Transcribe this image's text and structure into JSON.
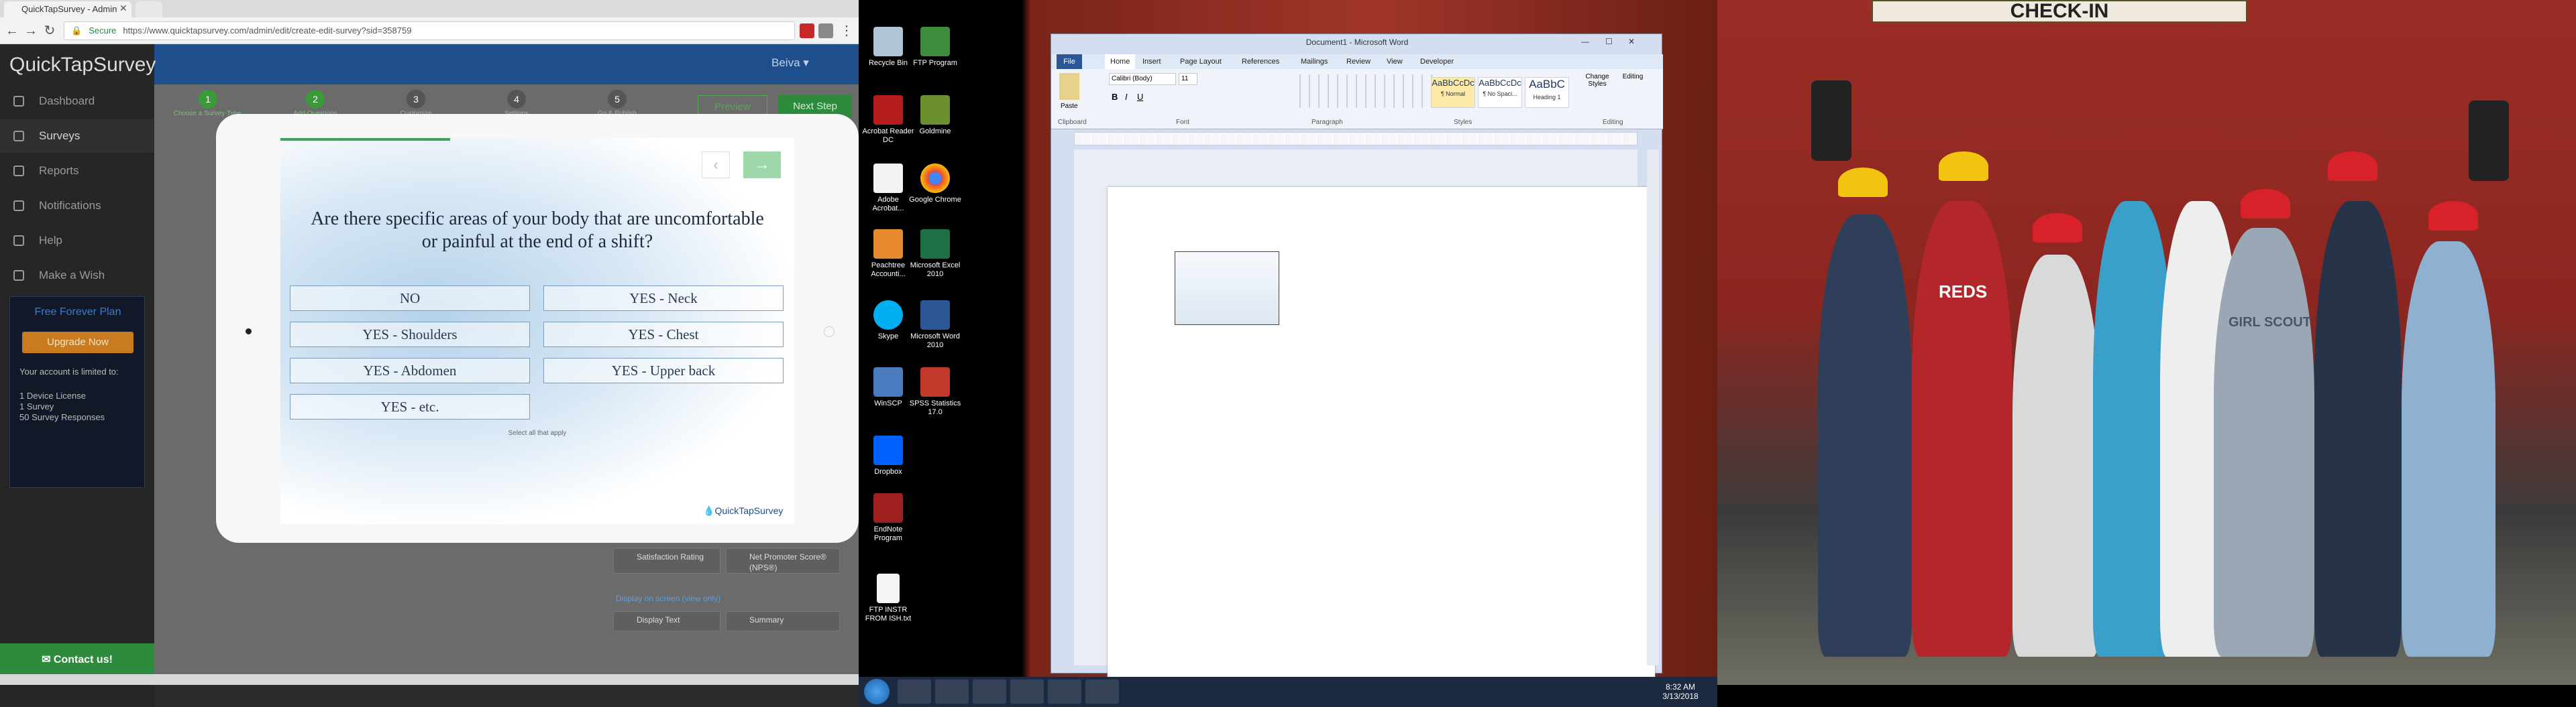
{
  "browser": {
    "tab_title": "QuickTapSurvey - Admin",
    "tab2_title": "",
    "secure_label": "Secure",
    "url": "https://www.quicktapsurvey.com/admin/edit/create-edit-survey?sid=358759"
  },
  "app": {
    "brand": "QuickTapSurvey",
    "user": "Beiva",
    "sidebar": [
      {
        "label": "Dashboard"
      },
      {
        "label": "Surveys"
      },
      {
        "label": "Reports"
      },
      {
        "label": "Notifications"
      },
      {
        "label": "Help"
      },
      {
        "label": "Make a Wish"
      }
    ],
    "plan": {
      "title": "Free Forever Plan",
      "upgrade": "Upgrade Now",
      "limited": "Your account is limited to:",
      "device": "1 Device License",
      "survey": "1 Survey",
      "responses": "50 Survey Responses"
    },
    "contact": "Contact us!",
    "steps": [
      "Choose a Survey Type",
      "Add Questions",
      "Customize",
      "Settings",
      "Go & Publish"
    ],
    "preview": "Preview",
    "next": "Next Step",
    "panel": {
      "satisfaction": "Satisfaction Rating",
      "nps": "Net Promoter Score® (NPS®)",
      "display_heading": "Display on screen (view only)",
      "display_text": "Display Text",
      "summary": "Summary"
    }
  },
  "survey": {
    "question": "Are there specific areas of your body that are uncomfortable or painful at the end of a shift?",
    "options": [
      "NO",
      "YES - Neck",
      "YES - Shoulders",
      "YES - Chest",
      "YES - Abdomen",
      "YES - Upper back",
      "YES - etc."
    ],
    "hint": "Select all that apply",
    "logo": "QuickTapSurvey",
    "progress_fraction": 0.33
  },
  "desktop": {
    "icons": [
      {
        "label": "Recycle Bin"
      },
      {
        "label": "FTP Program"
      },
      {
        "label": "Acrobat Reader DC"
      },
      {
        "label": "Goldmine"
      },
      {
        "label": "Adobe Acrobat..."
      },
      {
        "label": "Google Chrome"
      },
      {
        "label": "Peachtree Accounti..."
      },
      {
        "label": "Microsoft Excel 2010"
      },
      {
        "label": "Skype"
      },
      {
        "label": "Microsoft Word 2010"
      },
      {
        "label": "WinSCP"
      },
      {
        "label": "SPSS Statistics 17.0"
      },
      {
        "label": "Dropbox"
      },
      {
        "label": "EndNote Program"
      },
      {
        "label": "FTP INSTR FROM ISH.txt"
      }
    ],
    "clock_time": "8:32 AM",
    "clock_date": "3/13/2018"
  },
  "word": {
    "title": "Document1 - Microsoft Word",
    "tabs": [
      "File",
      "Home",
      "Insert",
      "Page Layout",
      "References",
      "Mailings",
      "Review",
      "View",
      "Developer"
    ],
    "font": "Calibri (Body)",
    "size": "11",
    "groups": [
      "Clipboard",
      "Font",
      "Paragraph",
      "Styles",
      "Editing"
    ],
    "styles": [
      {
        "sample": "AaBbCcDc",
        "name": "¶ Normal"
      },
      {
        "sample": "AaBbCcDc",
        "name": "¶ No Spaci..."
      },
      {
        "sample": "AaBbC",
        "name": "Heading 1"
      }
    ],
    "change_styles": "Change Styles",
    "editing": "Editing",
    "paste": "Paste"
  },
  "photo": {
    "sign_text": "CHECK-IN",
    "shirt_text": "REDS",
    "shirt2_text": "GIRL SCOUT"
  }
}
